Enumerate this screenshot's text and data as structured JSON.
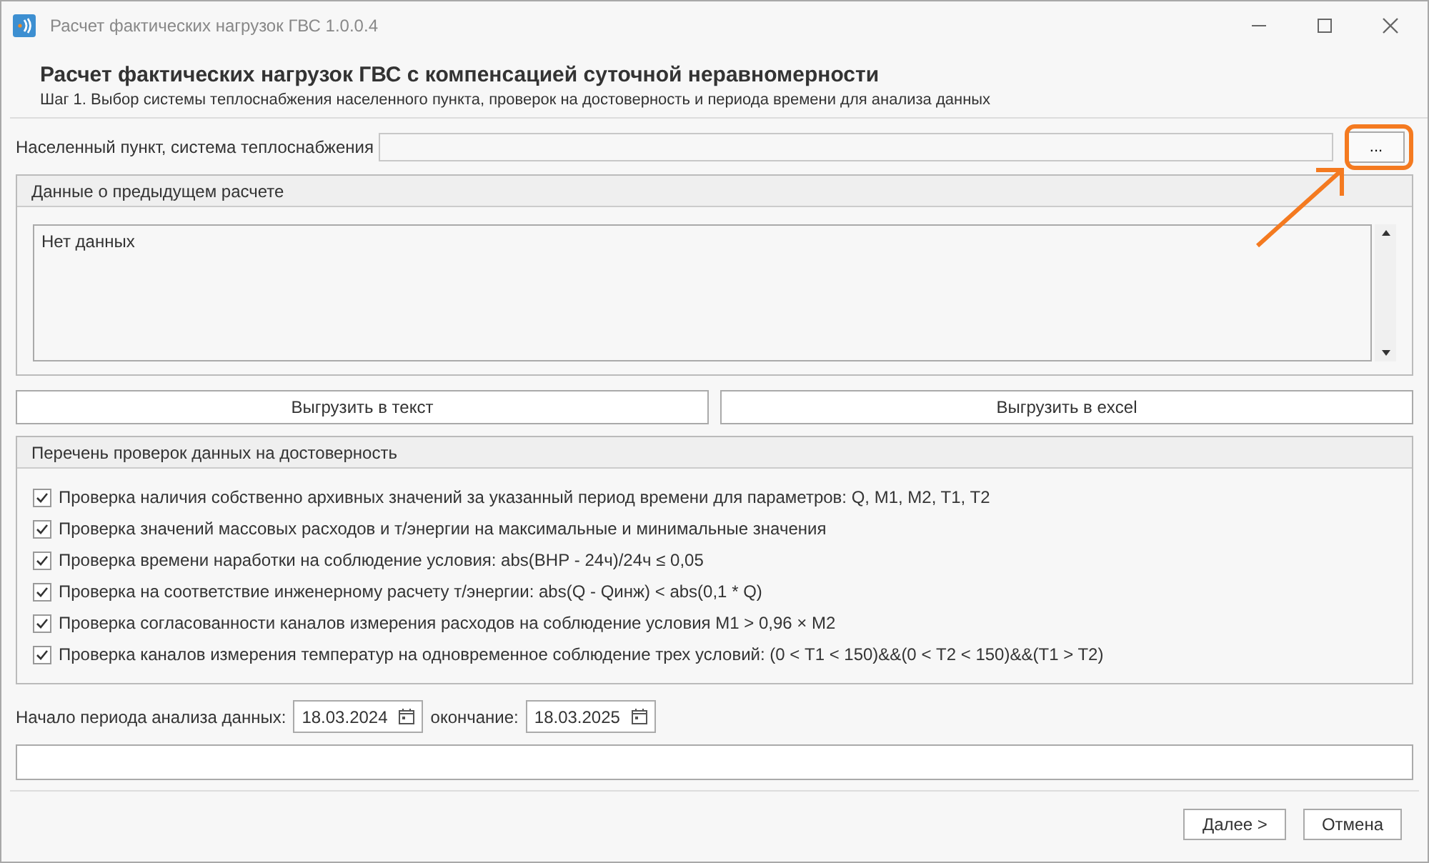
{
  "window": {
    "title": "Расчет фактических нагрузок ГВС 1.0.0.4"
  },
  "header": {
    "title": "Расчет фактических нагрузок ГВС с компенсацией суточной неравномерности",
    "subtitle": "Шаг 1. Выбор системы теплоснабжения населенного пункта, проверок на достоверность и периода времени для анализа данных"
  },
  "system_field": {
    "label": "Населенный пункт, система теплоснабжения",
    "browse_button": "...",
    "highlighted": true
  },
  "previous_calc": {
    "title": "Данные о предыдущем расчете",
    "text": "Нет данных"
  },
  "export_buttons": [
    "Выгрузить в текст",
    "Выгрузить в excel"
  ],
  "checks": {
    "title": "Перечень проверок данных на достоверность",
    "items": [
      {
        "label": "Проверка наличия собственно архивных значений за указанный период времени для параметров: Q, M1, M2, T1, T2",
        "checked": true
      },
      {
        "label": "Проверка значений массовых расходов и т/энергии на максимальные и минимальные значения",
        "checked": true
      },
      {
        "label": "Проверка времени наработки на соблюдение условия: abs(ВНР - 24ч)/24ч ≤ 0,05",
        "checked": true
      },
      {
        "label": "Проверка на соответствие инженерному расчету т/энергии: abs(Q - Qинж) < abs(0,1 * Q)",
        "checked": true
      },
      {
        "label": "Проверка согласованности каналов измерения расходов на соблюдение условия M1 > 0,96 × M2",
        "checked": true
      },
      {
        "label": "Проверка каналов измерения температур на одновременное соблюдение трех условий: (0 < T1 < 150)&&(0 < T2 < 150)&&(T1 > T2)",
        "checked": true
      }
    ]
  },
  "period": {
    "start_label": "Начало периода анализа данных:",
    "start": "18.03.2024",
    "end_label": "окончание:",
    "end": "18.03.2025"
  },
  "buttons": [
    "Далее >",
    "Отмена"
  ]
}
